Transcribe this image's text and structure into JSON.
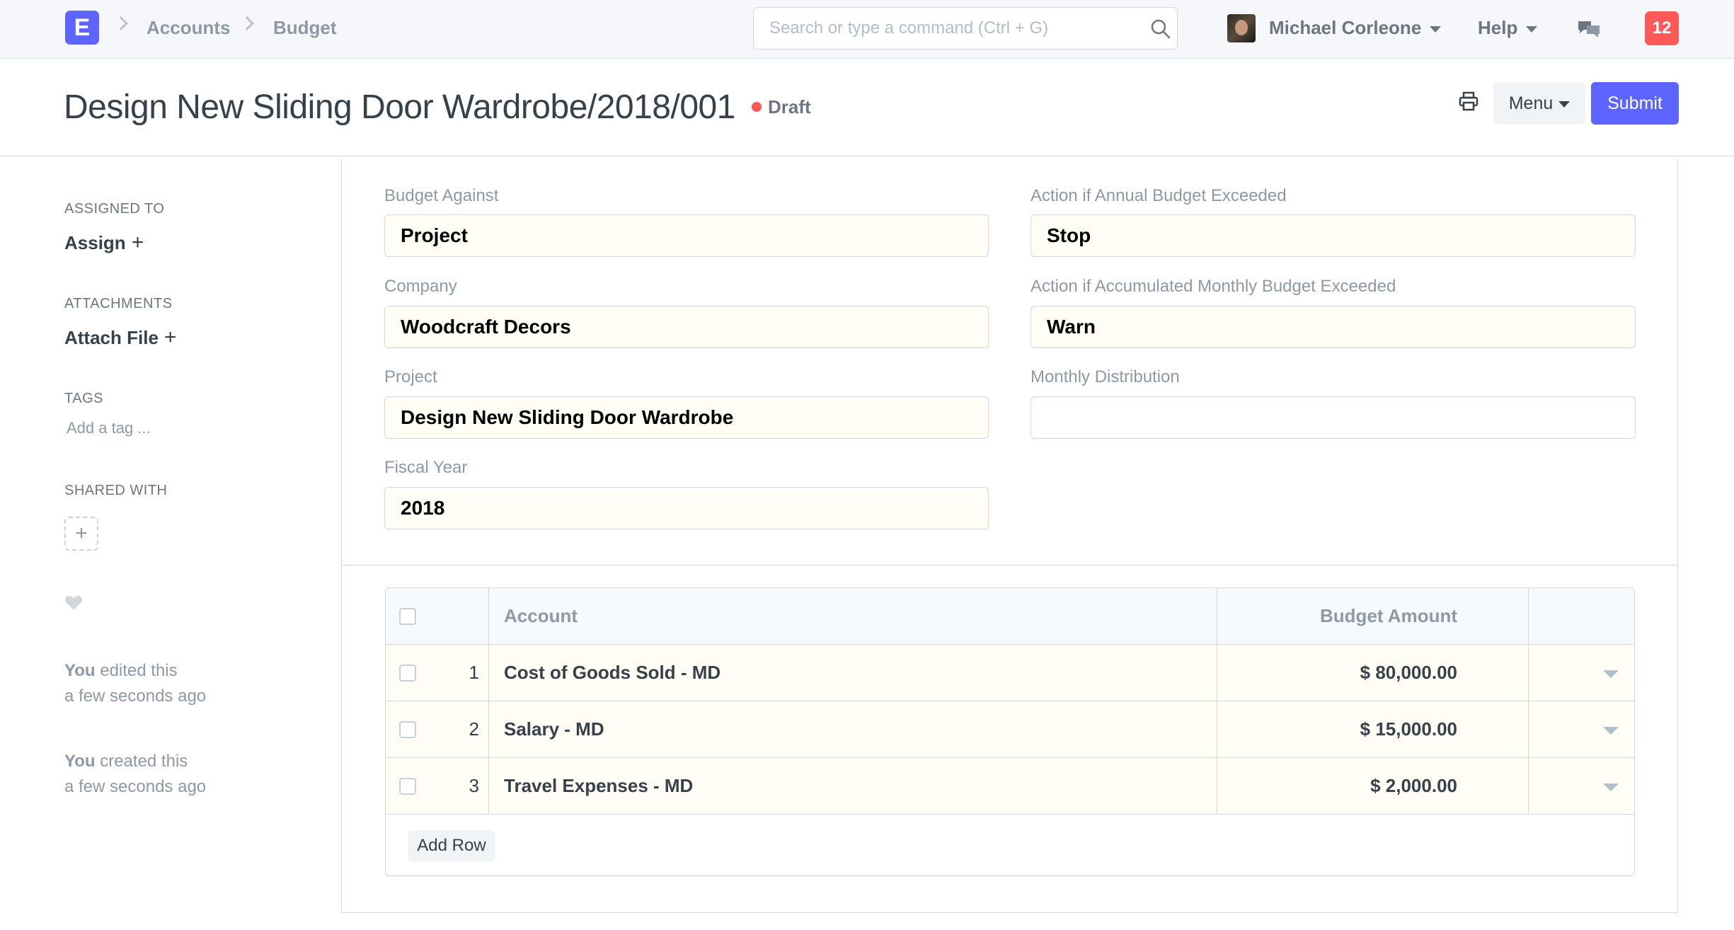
{
  "navbar": {
    "logo_letter": "E",
    "breadcrumbs": [
      "Accounts",
      "Budget"
    ],
    "search_placeholder": "Search or type a command (Ctrl + G)",
    "user_name": "Michael Corleone",
    "help_label": "Help",
    "notification_count": "12"
  },
  "page": {
    "title": "Design New Sliding Door Wardrobe/2018/001",
    "status": "Draft",
    "menu_label": "Menu",
    "submit_label": "Submit"
  },
  "sidebar": {
    "assigned_to_label": "ASSIGNED TO",
    "assign_action": "Assign",
    "attachments_label": "ATTACHMENTS",
    "attach_action": "Attach File",
    "tags_label": "TAGS",
    "tag_placeholder": "Add a tag ...",
    "shared_with_label": "SHARED WITH",
    "timeline": [
      {
        "actor": "You",
        "action": " edited this",
        "when": "a few seconds ago"
      },
      {
        "actor": "You",
        "action": " created this",
        "when": "a few seconds ago"
      }
    ]
  },
  "form": {
    "left": [
      {
        "label": "Budget Against",
        "value": "Project"
      },
      {
        "label": "Company",
        "value": "Woodcraft Decors"
      },
      {
        "label": "Project",
        "value": "Design New Sliding Door Wardrobe"
      },
      {
        "label": "Fiscal Year",
        "value": "2018"
      }
    ],
    "right": [
      {
        "label": "Action if Annual Budget Exceeded",
        "value": "Stop"
      },
      {
        "label": "Action if Accumulated Monthly Budget Exceeded",
        "value": "Warn"
      },
      {
        "label": "Monthly Distribution",
        "value": ""
      }
    ]
  },
  "accounts_table": {
    "columns": [
      "Account",
      "Budget Amount"
    ],
    "rows": [
      {
        "idx": "1",
        "account": "Cost of Goods Sold - MD",
        "amount": "$ 80,000.00"
      },
      {
        "idx": "2",
        "account": "Salary - MD",
        "amount": "$ 15,000.00"
      },
      {
        "idx": "3",
        "account": "Travel Expenses - MD",
        "amount": "$ 2,000.00"
      }
    ],
    "add_row_label": "Add Row"
  },
  "colors": {
    "primary": "#5e64ff",
    "status_draft": "#ff5858",
    "field_bg": "#fffdf4"
  }
}
